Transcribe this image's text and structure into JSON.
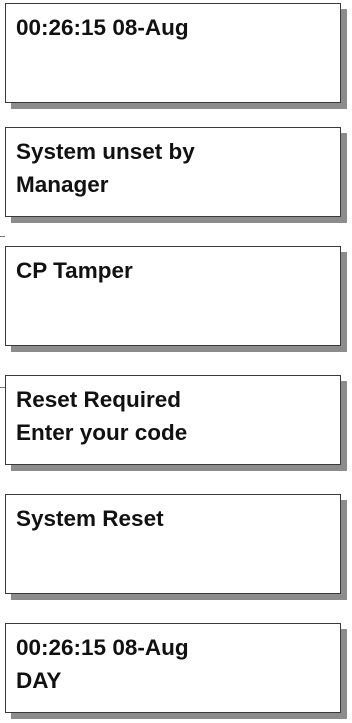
{
  "displays": [
    {
      "line1": "00:26:15 08-Aug",
      "line2": ""
    },
    {
      "line1": "System unset by",
      "line2": "Manager"
    },
    {
      "line1": "CP Tamper",
      "line2": ""
    },
    {
      "line1": "Reset Required",
      "line2": "Enter your code"
    },
    {
      "line1": "System Reset",
      "line2": ""
    },
    {
      "line1": "00:26:15 08-Aug",
      "line2": "DAY"
    }
  ]
}
